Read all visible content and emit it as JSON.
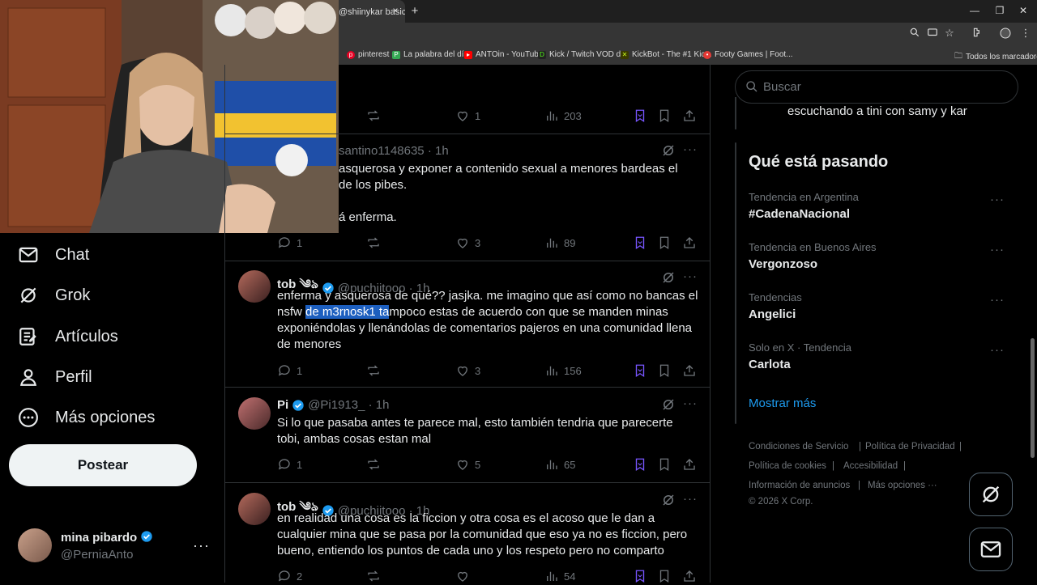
{
  "browser": {
    "tab_title": "@shiinykar basic",
    "tab_close": "×",
    "new_tab": "+",
    "window_controls": [
      "—",
      "❐",
      "✕"
    ],
    "bookmarks": [
      {
        "label": "pinterest",
        "icon": "pinterest-icon",
        "color": "#e60023"
      },
      {
        "label": "La palabra del día",
        "icon": "bookmark-green-icon",
        "color": "#34a853"
      },
      {
        "label": "ANTOin - YouTube",
        "icon": "youtube-icon",
        "color": "#ff0000"
      },
      {
        "label": "Kick / Twitch VOD d...",
        "icon": "kick-icon",
        "color": "#53fc18"
      },
      {
        "label": "KickBot - The #1 Kic...",
        "icon": "kickbot-icon",
        "color": "#c6f91f"
      },
      {
        "label": "Footy Games | Foot...",
        "icon": "footy-icon",
        "color": "#e53935"
      }
    ],
    "all_bookmarks": "Todos los marcadores"
  },
  "nav": {
    "items": [
      {
        "label": "Chat",
        "icon": "mail-icon"
      },
      {
        "label": "Grok",
        "icon": "grok-icon"
      },
      {
        "label": "Artículos",
        "icon": "articles-icon"
      },
      {
        "label": "Perfil",
        "icon": "profile-icon"
      },
      {
        "label": "Más opciones",
        "icon": "more-options-icon"
      }
    ],
    "post_button": "Postear"
  },
  "account": {
    "name": "mina pibardo",
    "handle": "@PerniaAnto",
    "more": "···"
  },
  "tweets": [
    {
      "partial_top": true,
      "stats": {
        "replies": "",
        "retweets": "",
        "likes": "1",
        "views": "203"
      }
    },
    {
      "handle": "santino1148635 · 1h",
      "lines": [
        "asquerosa y exponer a contenido sexual a menores bardeas el",
        "de los pibes.",
        "",
        "á enferma."
      ],
      "stats": {
        "replies": "1",
        "retweets": "",
        "likes": "3",
        "views": "89"
      }
    },
    {
      "name": "tob ༄ঌ",
      "handle": "@puchiitooo · 1h",
      "text_pre": "enferma y asquerosa de qué?? jasjka. me imagino que así como no bancas el nsfw ",
      "text_highlight": "de m3rnosk1 ta",
      "text_post": "mpoco estas de acuerdo con que se manden minas exponiéndolas y llenándolas de comentarios pajeros en una comunidad llena de menores",
      "stats": {
        "replies": "1",
        "retweets": "",
        "likes": "3",
        "views": "156"
      }
    },
    {
      "name": "Pi",
      "handle": "@Pi1913_ · 1h",
      "text": "Si lo que pasaba antes te parece mal, esto también tendria que parecerte tobi, ambas cosas estan mal",
      "stats": {
        "replies": "1",
        "retweets": "",
        "likes": "5",
        "views": "65"
      }
    },
    {
      "name": "tob ༄ঌ",
      "handle": "@puchiitooo · 1h",
      "text": "en realidad una cosa es la ficcion y otra cosa es el acoso que le dan a cualquier mina que se pasa por la comunidad que eso ya no es ficcion, pero bueno, entiendo los puntos de cada uno y los respeto pero no comparto",
      "stats": {
        "replies": "2",
        "retweets": "",
        "likes": "",
        "views": "54"
      }
    }
  ],
  "search": {
    "placeholder": "Buscar"
  },
  "space_card": {
    "text": "escuchando a tini con samy y kar"
  },
  "trends": {
    "title": "Qué está pasando",
    "items": [
      {
        "meta": "Tendencia en Argentina",
        "name": "#CadenaNacional"
      },
      {
        "meta": "Tendencia en Buenos Aires",
        "name": "Vergonzoso"
      },
      {
        "meta": "Tendencias",
        "name": "Angelici"
      },
      {
        "meta": "Solo en X · Tendencia",
        "name": "Carlota"
      }
    ],
    "show_more": "Mostrar más"
  },
  "footer": {
    "links": [
      "Condiciones de Servicio",
      "Política de Privacidad",
      "Política de cookies",
      "Accesibilidad",
      "Información de anuncios",
      "Más opciones ···"
    ],
    "copyright": "© 2026 X Corp."
  },
  "colors": {
    "accent": "#1d9bf0",
    "bookmark_accent": "#7856ff",
    "border": "#2f3336",
    "muted": "#71767b"
  }
}
